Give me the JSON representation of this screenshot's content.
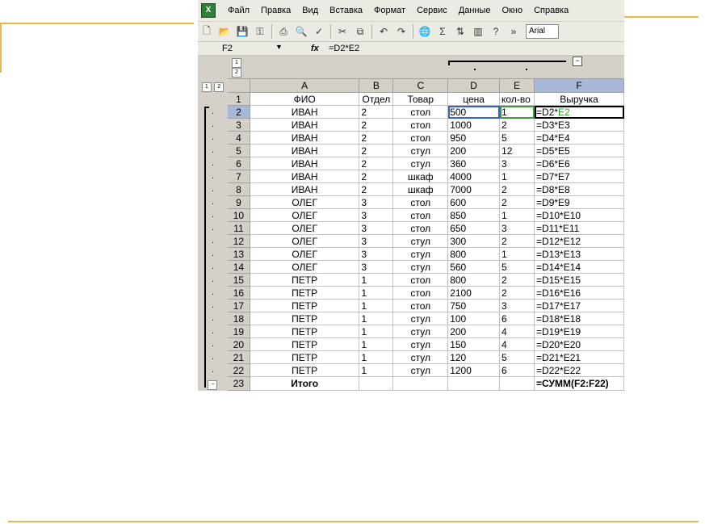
{
  "menu": {
    "icon": "excel-app-icon",
    "items": [
      "Файл",
      "Правка",
      "Вид",
      "Вставка",
      "Формат",
      "Сервис",
      "Данные",
      "Окно",
      "Справка"
    ]
  },
  "toolbar": {
    "icons": [
      "new-icon",
      "open-icon",
      "save-icon",
      "permission-icon",
      "print-icon",
      "preview-icon",
      "spelling-icon",
      "cut-icon",
      "copy-icon",
      "undo-icon",
      "redo-icon",
      "hyperlink-icon",
      "sum-icon",
      "sort-icon",
      "chart-icon",
      "help-icon",
      "more-icon"
    ],
    "font": "Arial"
  },
  "formula_bar": {
    "name_box": "F2",
    "fx": "fx",
    "formula": "=D2*E2"
  },
  "outline": {
    "row_levels": [
      "1",
      "2"
    ],
    "col_levels": [
      "1",
      "2"
    ],
    "collapse": "−"
  },
  "columns": [
    "A",
    "B",
    "C",
    "D",
    "E",
    "F"
  ],
  "header_row": {
    "num": "1",
    "cells": [
      "ФИО",
      "Отдел",
      "Товар",
      "цена",
      "кол-во",
      "Выручка"
    ]
  },
  "rows": [
    {
      "num": "2",
      "a": "ИВАН",
      "b": "2",
      "c": "стол",
      "d": "500",
      "e": "1",
      "f": "=D2*E2"
    },
    {
      "num": "3",
      "a": "ИВАН",
      "b": "2",
      "c": "стол",
      "d": "1000",
      "e": "2",
      "f": "=D3*E3"
    },
    {
      "num": "4",
      "a": "ИВАН",
      "b": "2",
      "c": "стол",
      "d": "950",
      "e": "5",
      "f": "=D4*E4"
    },
    {
      "num": "5",
      "a": "ИВАН",
      "b": "2",
      "c": "стул",
      "d": "200",
      "e": "12",
      "f": "=D5*E5"
    },
    {
      "num": "6",
      "a": "ИВАН",
      "b": "2",
      "c": "стул",
      "d": "360",
      "e": "3",
      "f": "=D6*E6"
    },
    {
      "num": "7",
      "a": "ИВАН",
      "b": "2",
      "c": "шкаф",
      "d": "4000",
      "e": "1",
      "f": "=D7*E7"
    },
    {
      "num": "8",
      "a": "ИВАН",
      "b": "2",
      "c": "шкаф",
      "d": "7000",
      "e": "2",
      "f": "=D8*E8"
    },
    {
      "num": "9",
      "a": "ОЛЕГ",
      "b": "3",
      "c": "стол",
      "d": "600",
      "e": "2",
      "f": "=D9*E9"
    },
    {
      "num": "10",
      "a": "ОЛЕГ",
      "b": "3",
      "c": "стол",
      "d": "850",
      "e": "1",
      "f": "=D10*E10"
    },
    {
      "num": "11",
      "a": "ОЛЕГ",
      "b": "3",
      "c": "стол",
      "d": "650",
      "e": "3",
      "f": "=D11*E11"
    },
    {
      "num": "12",
      "a": "ОЛЕГ",
      "b": "3",
      "c": "стул",
      "d": "300",
      "e": "2",
      "f": "=D12*E12"
    },
    {
      "num": "13",
      "a": "ОЛЕГ",
      "b": "3",
      "c": "стул",
      "d": "800",
      "e": "1",
      "f": "=D13*E13"
    },
    {
      "num": "14",
      "a": "ОЛЕГ",
      "b": "3",
      "c": "стул",
      "d": "560",
      "e": "5",
      "f": "=D14*E14"
    },
    {
      "num": "15",
      "a": "ПЕТР",
      "b": "1",
      "c": "стол",
      "d": "800",
      "e": "2",
      "f": "=D15*E15"
    },
    {
      "num": "16",
      "a": "ПЕТР",
      "b": "1",
      "c": "стол",
      "d": "2100",
      "e": "2",
      "f": "=D16*E16"
    },
    {
      "num": "17",
      "a": "ПЕТР",
      "b": "1",
      "c": "стол",
      "d": "750",
      "e": "3",
      "f": "=D17*E17"
    },
    {
      "num": "18",
      "a": "ПЕТР",
      "b": "1",
      "c": "стул",
      "d": "100",
      "e": "6",
      "f": "=D18*E18"
    },
    {
      "num": "19",
      "a": "ПЕТР",
      "b": "1",
      "c": "стул",
      "d": "200",
      "e": "4",
      "f": "=D19*E19"
    },
    {
      "num": "20",
      "a": "ПЕТР",
      "b": "1",
      "c": "стул",
      "d": "150",
      "e": "4",
      "f": "=D20*E20"
    },
    {
      "num": "21",
      "a": "ПЕТР",
      "b": "1",
      "c": "стул",
      "d": "120",
      "e": "5",
      "f": "=D21*E21"
    },
    {
      "num": "22",
      "a": "ПЕТР",
      "b": "1",
      "c": "стул",
      "d": "1200",
      "e": "6",
      "f": "=D22*E22"
    }
  ],
  "total_row": {
    "num": "23",
    "label": "Итого",
    "formula": "=СУММ(F2:F22)"
  },
  "colors": {
    "accent_line": "#e8b84a",
    "selection_header": "#a7b8d8",
    "ref_green": "#2b9b2b"
  }
}
